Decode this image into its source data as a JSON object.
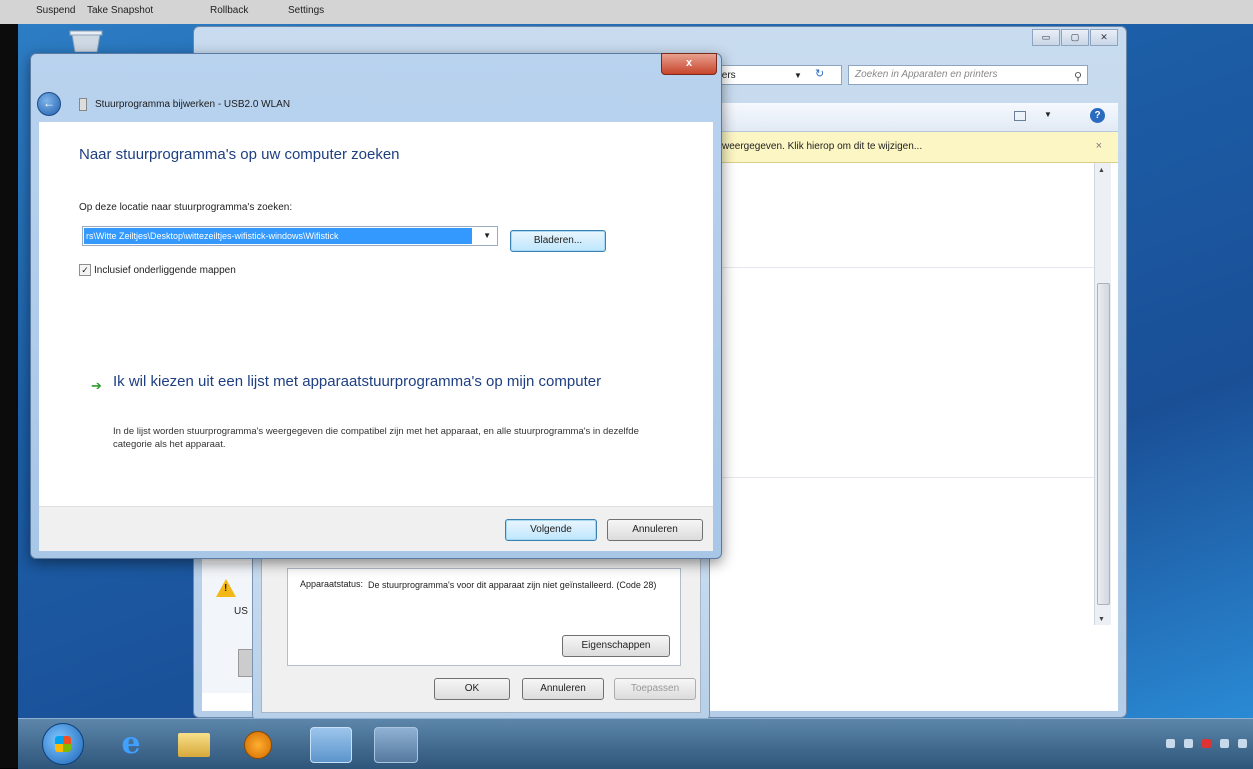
{
  "vm_menu": {
    "suspend": "Suspend",
    "snapshot": "Take Snapshot",
    "rollback": "Rollback",
    "settings": "Settings"
  },
  "explorer": {
    "address_text": "ters",
    "search_placeholder": "Zoeken in Apparaten en printers",
    "infobar_text": "weergegeven. Klik hierop om dit te wijzigen...",
    "infobar_close": "×",
    "device_label": "US"
  },
  "properties": {
    "status_label": "Apparaatstatus:",
    "status_text": "De stuurprogramma's voor dit apparaat zijn niet geïnstalleerd. (Code 28)",
    "properties_button": "Eigenschappen",
    "ok_button": "OK",
    "cancel_button": "Annuleren",
    "apply_button": "Toepassen"
  },
  "update_dialog": {
    "title": "Stuurprogramma bijwerken - USB2.0 WLAN",
    "close_label": "x",
    "heading": "Naar stuurprogramma's op uw computer zoeken",
    "location_label": "Op deze locatie naar stuurprogramma's zoeken:",
    "path_value": "rs\\Witte Zeiltjes\\Desktop\\wittezeiltjes-wifistick-windows\\Wifistick",
    "browse_button": "Bladeren...",
    "include_subfolders_label": "Inclusief onderliggende mappen",
    "include_subfolders_checked": "✓",
    "pick_link": "Ik wil kiezen uit een lijst met apparaatstuurprogramma's op mijn computer",
    "pick_description": "In de lijst worden stuurprogramma's weergegeven die compatibel zijn met het apparaat, en alle stuurprogramma's in dezelfde categorie als het apparaat.",
    "next_button": "Volgende",
    "cancel_button": "Annuleren"
  },
  "colors": {
    "heading": "#1e3f82",
    "selection": "#3399ff",
    "infobar": "#fcf6c4"
  }
}
